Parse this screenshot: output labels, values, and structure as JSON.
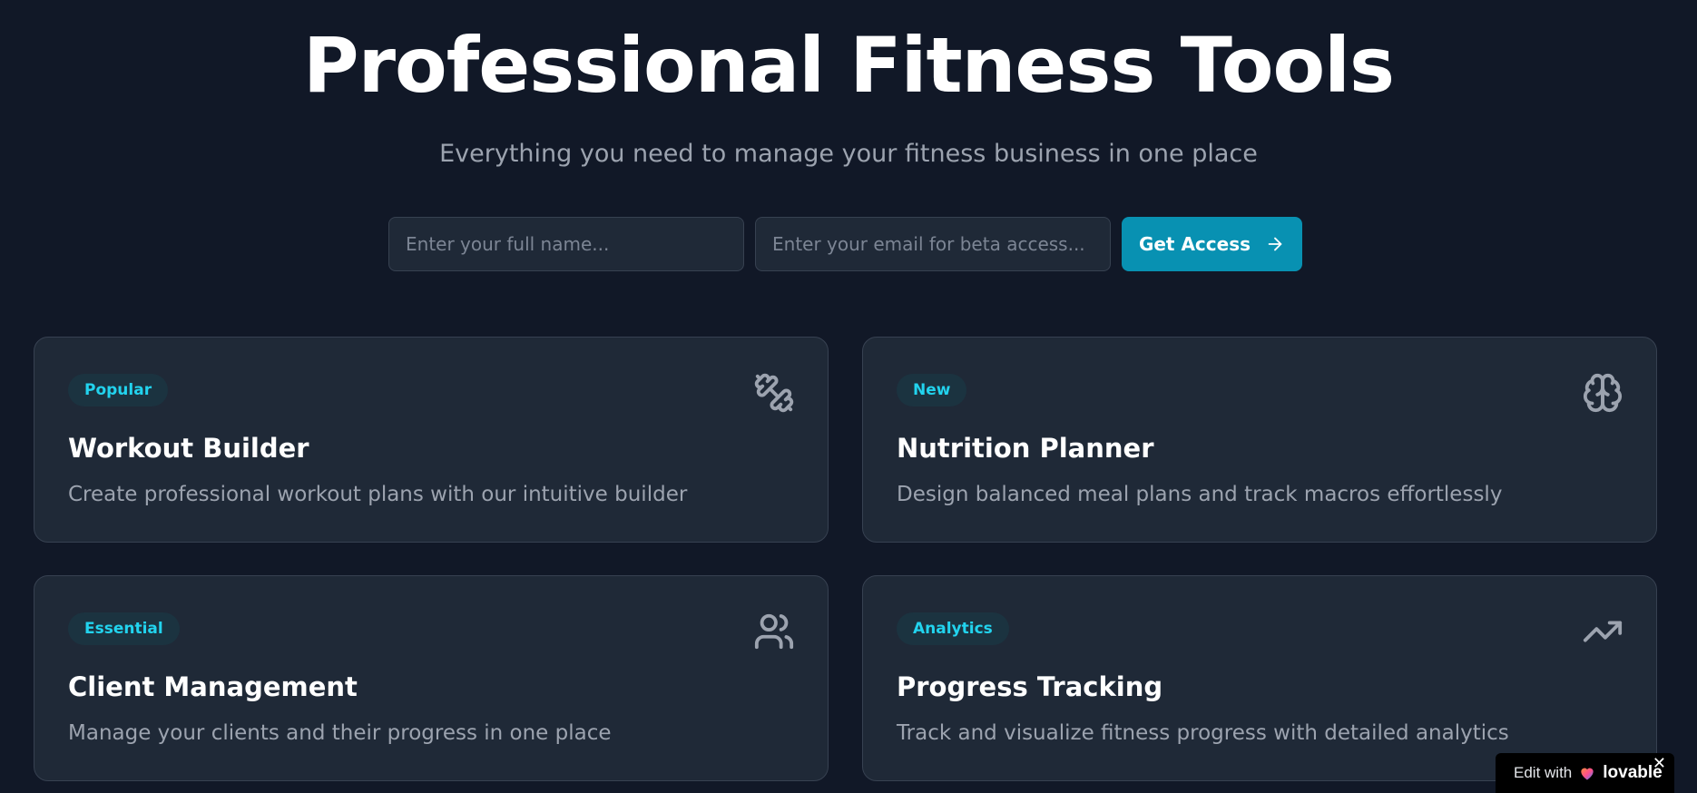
{
  "hero": {
    "title": "Professional Fitness Tools",
    "subtitle": "Everything you need to manage your fitness business in one place"
  },
  "signup": {
    "name_placeholder": "Enter your full name...",
    "email_placeholder": "Enter your email for beta access...",
    "button_label": "Get Access"
  },
  "cards": [
    {
      "badge": "Popular",
      "title": "Workout Builder",
      "description": "Create professional workout plans with our intuitive builder",
      "icon": "dumbbell-icon"
    },
    {
      "badge": "New",
      "title": "Nutrition Planner",
      "description": "Design balanced meal plans and track macros effortlessly",
      "icon": "brain-icon"
    },
    {
      "badge": "Essential",
      "title": "Client Management",
      "description": "Manage your clients and their progress in one place",
      "icon": "users-icon"
    },
    {
      "badge": "Analytics",
      "title": "Progress Tracking",
      "description": "Track and visualize fitness progress with detailed analytics",
      "icon": "trending-up-icon"
    }
  ],
  "lovable_badge": {
    "edit_label": "Edit with",
    "brand": "lovable",
    "close": "✕"
  },
  "colors": {
    "background": "#111827",
    "card": "#1f2937",
    "accent": "#0891b2",
    "badge_text": "#22d3ee"
  }
}
